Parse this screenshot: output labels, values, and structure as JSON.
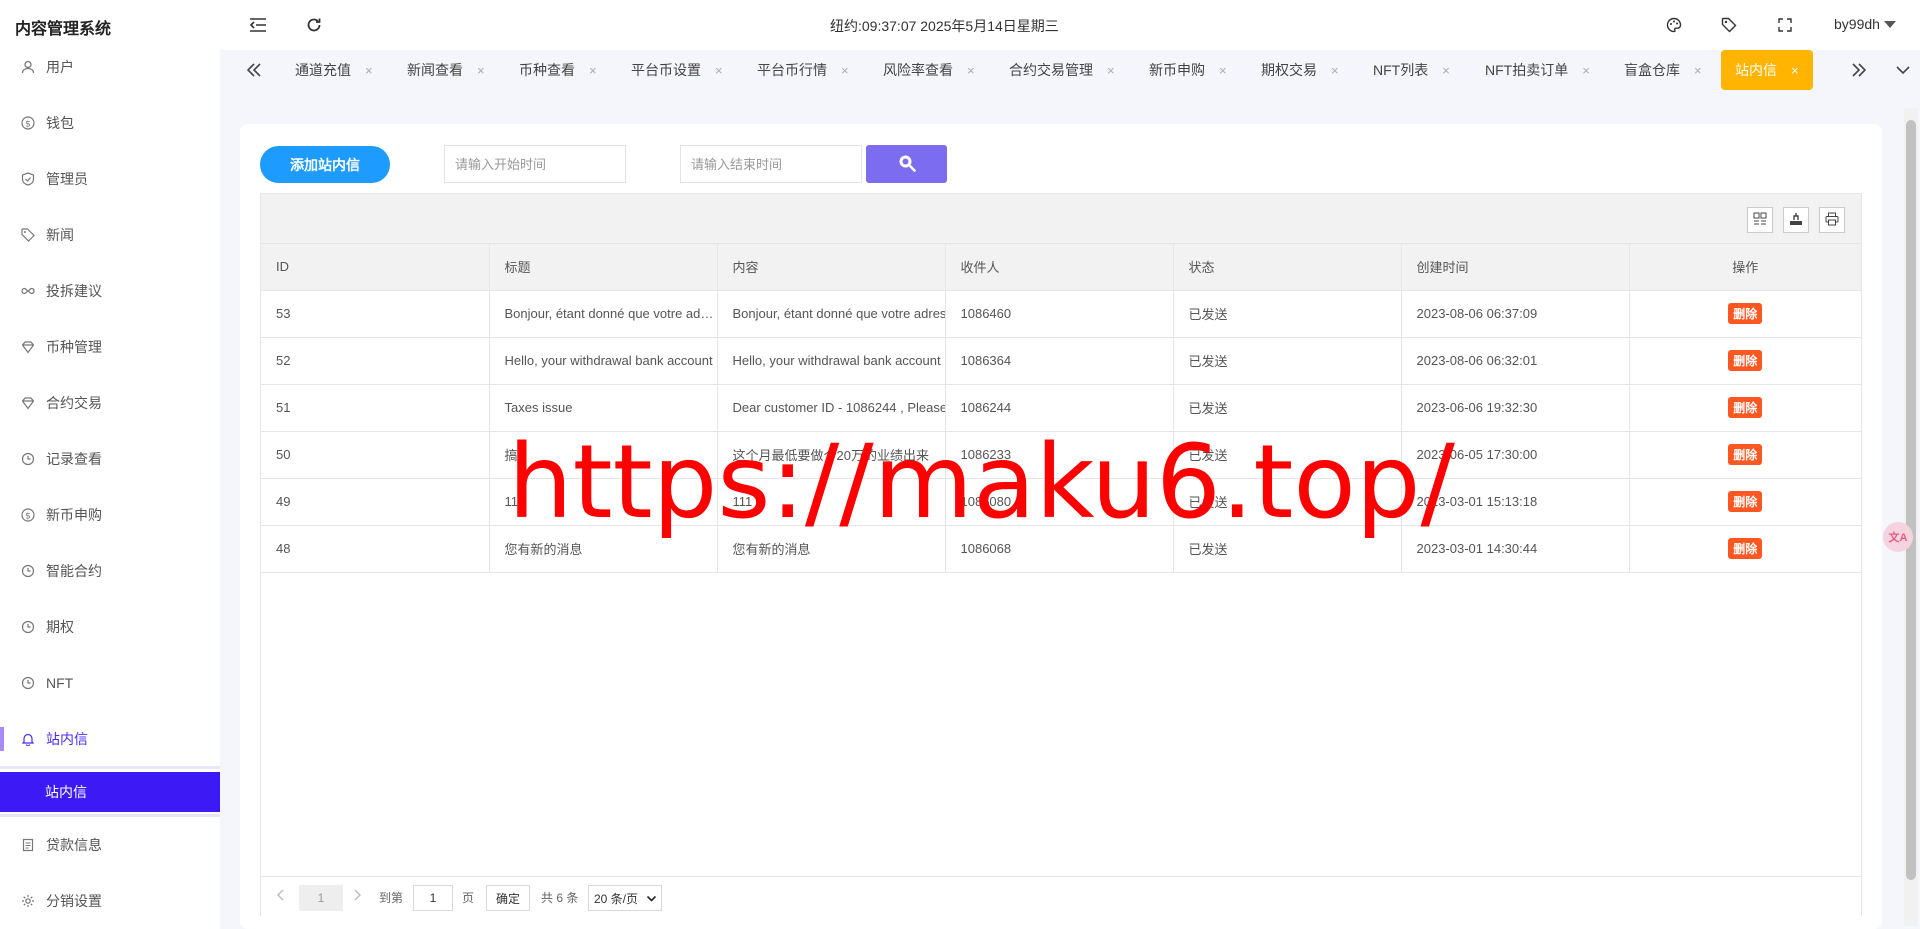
{
  "header": {
    "app_title": "内容管理系统",
    "clock": "纽约:09:37:07 2025年5月14日星期三",
    "username": "by99dh"
  },
  "sidebar": {
    "items": [
      {
        "label": "用户",
        "icon": "user-icon"
      },
      {
        "label": "钱包",
        "icon": "dollar-icon"
      },
      {
        "label": "管理员",
        "icon": "shield-icon"
      },
      {
        "label": "新闻",
        "icon": "tag-icon"
      },
      {
        "label": "投拆建议",
        "icon": "link-icon"
      },
      {
        "label": "币种管理",
        "icon": "diamond-icon"
      },
      {
        "label": "合约交易",
        "icon": "diamond-icon"
      },
      {
        "label": "记录查看",
        "icon": "refresh-icon"
      },
      {
        "label": "新币申购",
        "icon": "dollar-icon"
      },
      {
        "label": "智能合约",
        "icon": "refresh-icon"
      },
      {
        "label": "期权",
        "icon": "refresh-icon"
      },
      {
        "label": "NFT",
        "icon": "refresh-icon"
      },
      {
        "label": "站内信",
        "icon": "bell-icon",
        "active": true
      },
      {
        "label": "贷款信息",
        "icon": "document-icon"
      },
      {
        "label": "分销设置",
        "icon": "gear-icon"
      }
    ],
    "sub_item": "站内信",
    "active_color": "#4a2cf5"
  },
  "tabs": [
    {
      "label": "通道充值"
    },
    {
      "label": "新闻查看"
    },
    {
      "label": "币种查看"
    },
    {
      "label": "平台币设置"
    },
    {
      "label": "平台币行情"
    },
    {
      "label": "风险率查看"
    },
    {
      "label": "合约交易管理"
    },
    {
      "label": "新币申购"
    },
    {
      "label": "期权交易"
    },
    {
      "label": "NFT列表"
    },
    {
      "label": "NFT拍卖订单"
    },
    {
      "label": "盲盒仓库"
    },
    {
      "label": "站内信",
      "active": true
    }
  ],
  "tab_close_glyph": "×",
  "toolbar": {
    "add_label": "添加站内信",
    "start_placeholder": "请输入开始时间",
    "end_placeholder": "请输入结束时间"
  },
  "table": {
    "columns": [
      "ID",
      "标题",
      "内容",
      "收件人",
      "状态",
      "创建时间",
      "操作"
    ],
    "rows": [
      {
        "id": "53",
        "title": "Bonjour, étant donné que votre adresse",
        "content": "Bonjour, étant donné que votre adresse",
        "recipient": "1086460",
        "status": "已发送",
        "created": "2023-08-06 06:37:09"
      },
      {
        "id": "52",
        "title": "Hello, your withdrawal bank account",
        "content": "Hello, your withdrawal bank account",
        "recipient": "1086364",
        "status": "已发送",
        "created": "2023-08-06 06:32:01"
      },
      {
        "id": "51",
        "title": "Taxes issue",
        "content": "Dear customer ID - 1086244 , Please",
        "recipient": "1086244",
        "status": "已发送",
        "created": "2023-06-06 19:32:30"
      },
      {
        "id": "50",
        "title": "搞",
        "content": "这个月最低要做个20万的业绩出来",
        "recipient": "1086233",
        "status": "已发送",
        "created": "2023-06-05 17:30:00"
      },
      {
        "id": "49",
        "title": "111",
        "content": "111",
        "recipient": "1086080",
        "status": "已发送",
        "created": "2023-03-01 15:13:18"
      },
      {
        "id": "48",
        "title": "您有新的消息",
        "content": "您有新的消息",
        "recipient": "1086068",
        "status": "已发送",
        "created": "2023-03-01 14:30:44"
      }
    ],
    "delete_label": "删除"
  },
  "pager": {
    "current_page": "1",
    "goto_label": "到第",
    "goto_value": "1",
    "page_unit": "页",
    "confirm_label": "确定",
    "total_label": "共 6 条",
    "page_size": "20 条/页"
  },
  "translate_label": "文A",
  "watermark": "https://maku6.top/",
  "colors": {
    "primary_button": "#1e9bff",
    "search_button": "#7b6cf0",
    "active_tab": "#ffb400",
    "sub_menu_active": "#3d19f5",
    "delete_button": "#ff5722"
  }
}
